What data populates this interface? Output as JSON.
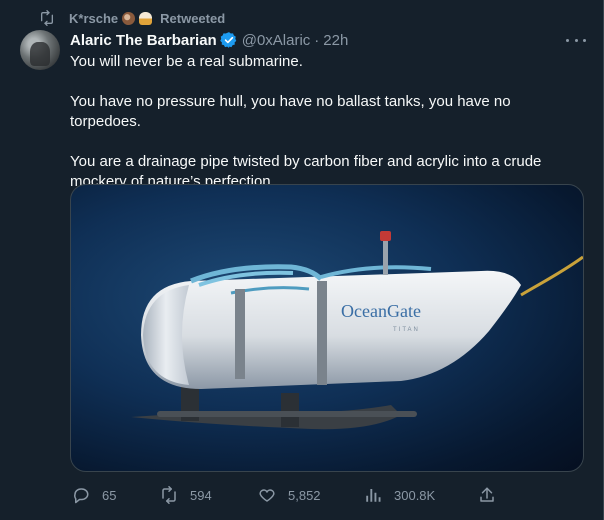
{
  "retweet_banner": {
    "user": "K*rsche",
    "label": "Retweeted"
  },
  "tweet": {
    "display_name": "Alaric The Barbarian",
    "handle": "@0xAlaric",
    "separator": "·",
    "time": "22h",
    "text": [
      "You will never be a real submarine.",
      "You have no pressure hull, you have no ballast tanks, you have no torpedoes.",
      "You are a drainage pipe twisted by carbon fiber and acrylic into a crude mockery of nature’s perfection"
    ],
    "media": {
      "brand": "OceanGate",
      "model": "TITAN"
    }
  },
  "actions": {
    "replies": "65",
    "retweets": "594",
    "likes": "5,852",
    "views": "300.8K"
  },
  "colors": {
    "background": "#15202b",
    "text": "#f7f9f9",
    "muted": "#8b98a5",
    "verified": "#1d9bf0",
    "border": "#38444d"
  },
  "icons": [
    "retweet-icon",
    "verified-badge-icon",
    "more-icon",
    "reply-icon",
    "like-icon",
    "views-icon",
    "share-icon"
  ]
}
